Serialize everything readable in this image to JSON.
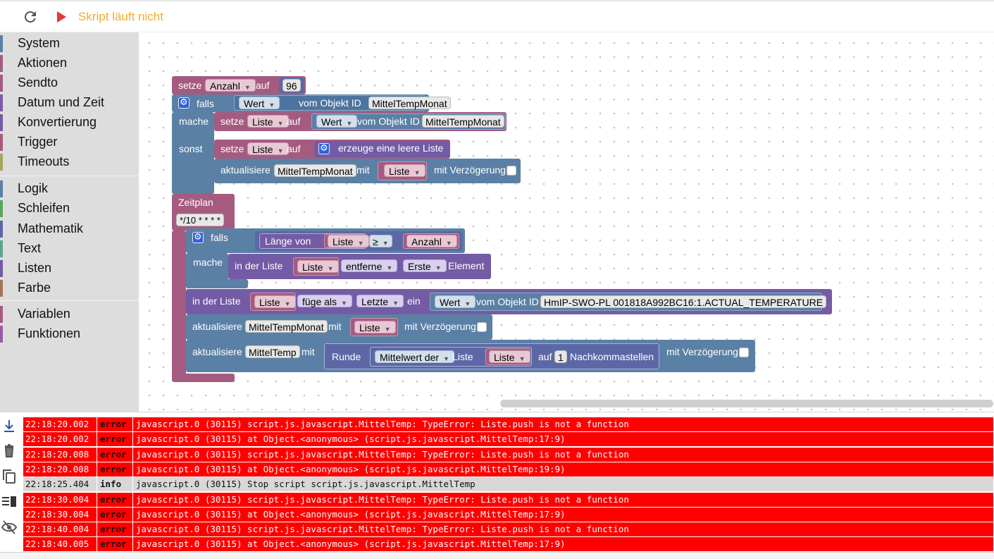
{
  "toolbar": {
    "reload_icon": "refresh-icon",
    "play_icon": "play-icon",
    "status": "Skript läuft nicht"
  },
  "categories": [
    {
      "label": "System",
      "color": "#5b80a5"
    },
    {
      "label": "Aktionen",
      "color": "#a55b80"
    },
    {
      "label": "Sendto",
      "color": "#a55b80"
    },
    {
      "label": "Datum und Zeit",
      "color": "#7b5ba5"
    },
    {
      "label": "Konvertierung",
      "color": "#745ba5"
    },
    {
      "label": "Trigger",
      "color": "#a55b80"
    },
    {
      "label": "Timeouts",
      "color": "#a5a55b"
    },
    {
      "label": "Logik",
      "color": "#5b80a5"
    },
    {
      "label": "Schleifen",
      "color": "#5ba55b"
    },
    {
      "label": "Mathematik",
      "color": "#5b67a5"
    },
    {
      "label": "Text",
      "color": "#5ba58c"
    },
    {
      "label": "Listen",
      "color": "#745ba5"
    },
    {
      "label": "Farbe",
      "color": "#a5745b"
    },
    {
      "label": "Variablen",
      "color": "#a55b80"
    },
    {
      "label": "Funktionen",
      "color": "#995ba5"
    }
  ],
  "blocks": {
    "b1": {
      "setze": "setze",
      "var": "Anzahl",
      "auf": "auf",
      "num": "96"
    },
    "b2": {
      "falls": "falls",
      "wert": "Wert",
      "vom": "vom Objekt ID",
      "obj": "MittelTempMonat",
      "mache": "mache",
      "sonst": "sonst"
    },
    "b3": {
      "setze": "setze",
      "var": "Liste",
      "auf": "auf",
      "wert": "Wert",
      "vom": "vom Objekt ID",
      "obj": "MittelTempMonat"
    },
    "b4": {
      "setze": "setze",
      "var": "Liste",
      "auf": "auf",
      "text": "erzeuge eine leere Liste"
    },
    "b5": {
      "akt": "aktualisiere",
      "obj": "MittelTempMonat",
      "mit": "mit",
      "var": "Liste",
      "delay": "mit Verzögerung"
    },
    "b6": {
      "zeitplan": "Zeitplan",
      "cron": "*/10 * * * *"
    },
    "b7": {
      "falls": "falls",
      "laenge": "Länge von",
      "var": "Liste",
      "op": "≥",
      "var2": "Anzahl",
      "mache": "mache"
    },
    "b8": {
      "inder": "in der Liste",
      "var": "Liste",
      "action": "entferne",
      "pos": "Erste",
      "element": "Element"
    },
    "b9": {
      "inder": "in der Liste",
      "var": "Liste",
      "fuege": "füge als",
      "pos": "Letzte",
      "ein": "ein",
      "wert": "Wert",
      "vom": "vom Objekt ID",
      "obj": "HmIP-SWO-PL 001818A992BC16:1.ACTUAL_TEMPERATURE"
    },
    "b10": {
      "akt": "aktualisiere",
      "obj": "MittelTempMonat",
      "mit": "mit",
      "var": "Liste",
      "delay": "mit Verzögerung"
    },
    "b11": {
      "akt": "aktualisiere",
      "obj": "MittelTemp",
      "mit": "mit",
      "runde": "Runde",
      "mw": "Mittelwert der",
      "liste": "Liste",
      "var": "Liste",
      "auf": "auf",
      "num": "1",
      "nk": "Nachkommastellen",
      "delay": "mit Verzögerung"
    }
  },
  "log_tools": [
    "scroll-down-icon",
    "clear-icon",
    "copy-icon",
    "columns-icon",
    "hide-icon"
  ],
  "log": [
    {
      "time": "22:18:20.002",
      "level": "error",
      "msg": "javascript.0 (30115) script.js.javascript.MittelTemp: TypeError: Liste.push is not a function"
    },
    {
      "time": "22:18:20.002",
      "level": "error",
      "msg": "javascript.0 (30115) at Object.<anonymous> (script.js.javascript.MittelTemp:17:9)"
    },
    {
      "time": "22:18:20.008",
      "level": "error",
      "msg": "javascript.0 (30115) script.js.javascript.MittelTemp: TypeError: Liste.push is not a function"
    },
    {
      "time": "22:18:20.008",
      "level": "error",
      "msg": "javascript.0 (30115) at Object.<anonymous> (script.js.javascript.MittelTemp:19:9)"
    },
    {
      "time": "22:18:25.404",
      "level": "info",
      "msg": "javascript.0 (30115) Stop script script.js.javascript.MittelTemp"
    },
    {
      "time": "22:18:30.004",
      "level": "error",
      "msg": "javascript.0 (30115) script.js.javascript.MittelTemp: TypeError: Liste.push is not a function"
    },
    {
      "time": "22:18:30.004",
      "level": "error",
      "msg": "javascript.0 (30115) at Object.<anonymous> (script.js.javascript.MittelTemp:17:9)"
    },
    {
      "time": "22:18:40.004",
      "level": "error",
      "msg": "javascript.0 (30115) script.js.javascript.MittelTemp: TypeError: Liste.push is not a function"
    },
    {
      "time": "22:18:40.005",
      "level": "error",
      "msg": "javascript.0 (30115) at Object.<anonymous> (script.js.javascript.MittelTemp:17:9)"
    }
  ]
}
